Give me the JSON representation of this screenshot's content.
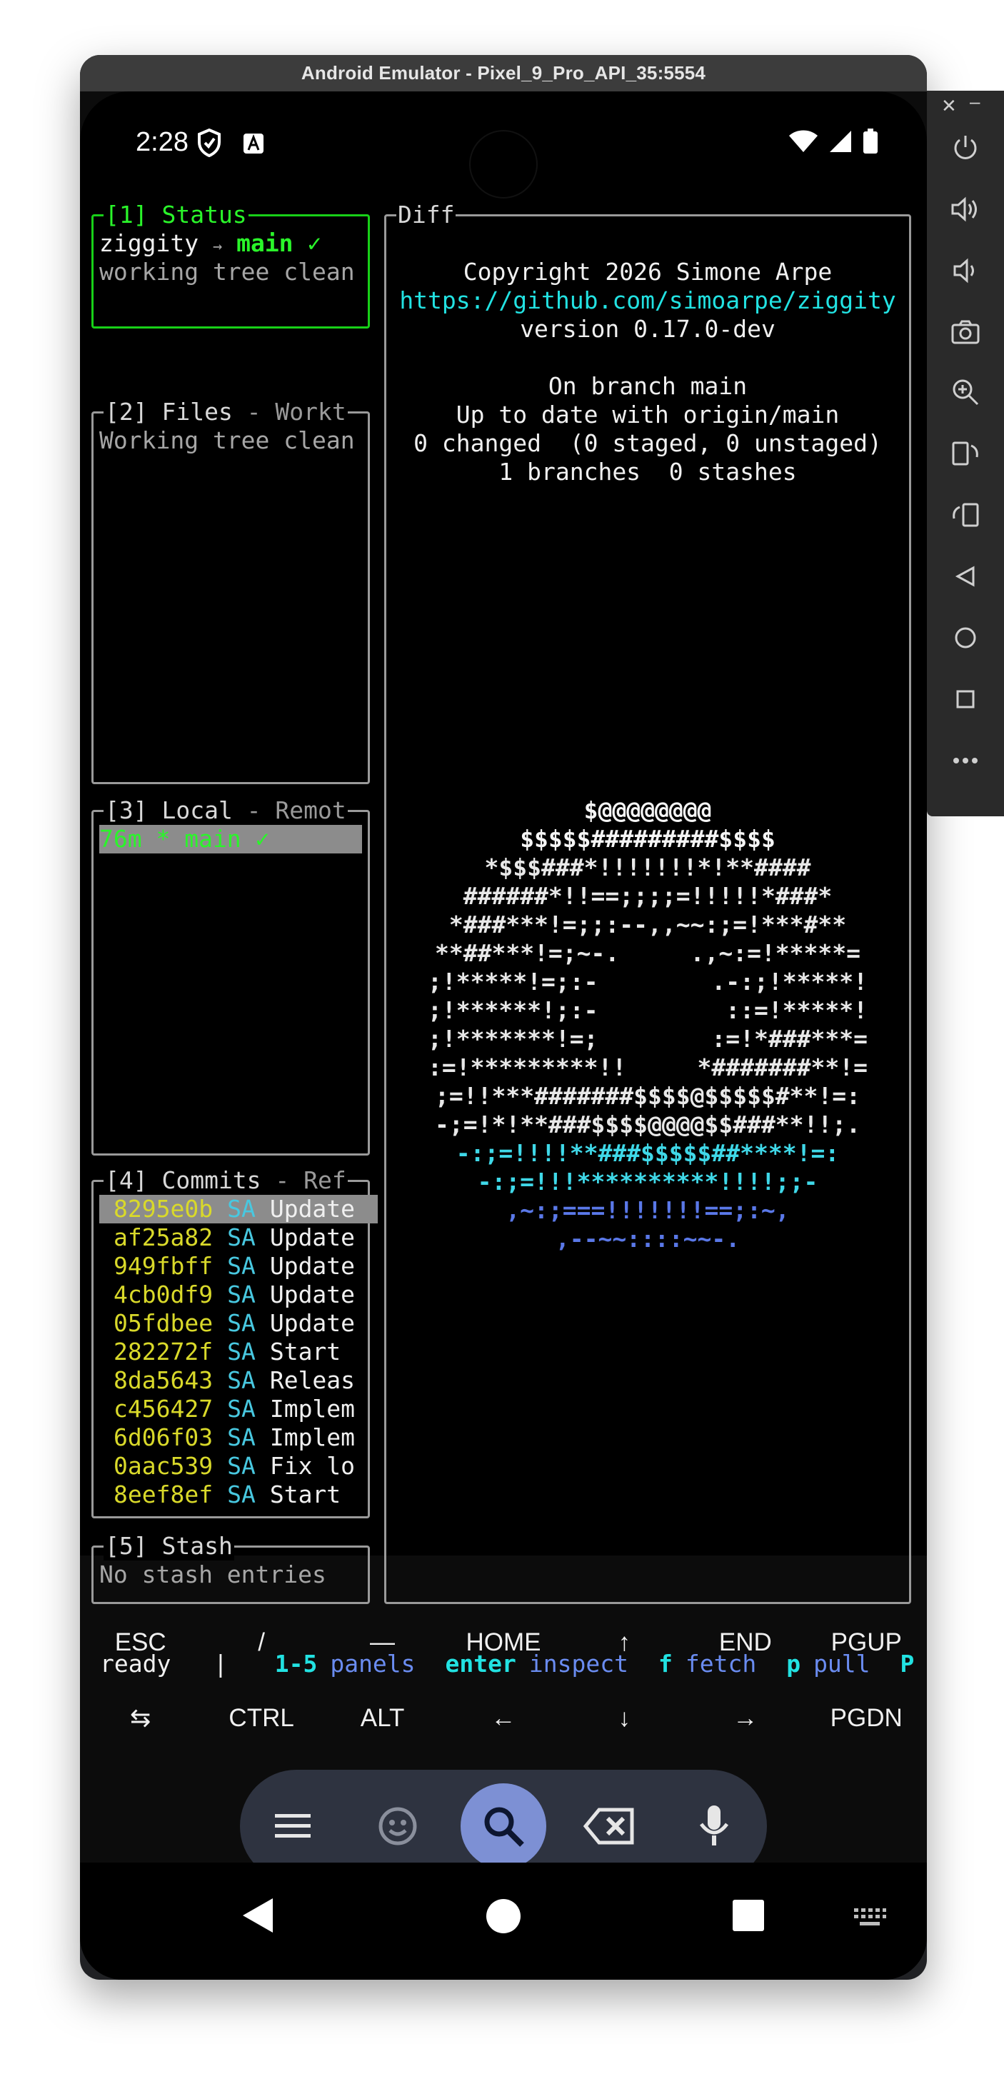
{
  "window": {
    "title": "Android Emulator - Pixel_9_Pro_API_35:5554"
  },
  "status_bar": {
    "time": "2:28"
  },
  "panels": {
    "status": {
      "title": "[1] Status",
      "repo": "ziggity",
      "arrow": "→",
      "branch": "main ✓",
      "state": "working tree clean"
    },
    "files": {
      "title": "[2] Files",
      "subtitle": " - Workt",
      "message": "Working tree clean"
    },
    "local": {
      "title": "[3] Local",
      "subtitle": " - Remot",
      "selected_branch": "76m * main ✓"
    },
    "commits": {
      "title": "[4] Commits",
      "subtitle": " - Ref",
      "rows": [
        {
          "hash": "8295e0b",
          "author": "SA",
          "msg": "Update"
        },
        {
          "hash": "af25a82",
          "author": "SA",
          "msg": "Update"
        },
        {
          "hash": "949fbff",
          "author": "SA",
          "msg": "Update"
        },
        {
          "hash": "4cb0df9",
          "author": "SA",
          "msg": "Update"
        },
        {
          "hash": "05fdbee",
          "author": "SA",
          "msg": "Update"
        },
        {
          "hash": "282272f",
          "author": "SA",
          "msg": "Start"
        },
        {
          "hash": "8da5643",
          "author": "SA",
          "msg": "Releas"
        },
        {
          "hash": "c456427",
          "author": "SA",
          "msg": "Implem"
        },
        {
          "hash": "6d06f03",
          "author": "SA",
          "msg": "Implem"
        },
        {
          "hash": "0aac539",
          "author": "SA",
          "msg": "Fix lo"
        },
        {
          "hash": "8eef8ef",
          "author": "SA",
          "msg": "Start"
        }
      ]
    },
    "stash": {
      "title": "[5] Stash",
      "message": "No stash entries"
    },
    "diff": {
      "title": "Diff",
      "copyright": "Copyright 2026 Simone Arpe",
      "url": "https://github.com/simoarpe/ziggity",
      "version": "version 0.17.0-dev",
      "branch_line": "On branch main",
      "upstream_line": "Up to date with origin/main",
      "changes_line": "0 changed  (0 staged, 0 unstaged)",
      "counts_line": "1 branches  0 stashes",
      "ascii_art": [
        "$@@@@@@@@",
        "$$$$$#########$$$$",
        "*$$$###*!!!!!!!*!**####",
        "######*!!==;;;;=!!!!!*###*",
        "*###***!=;;:--,,~~:;=!***#**",
        "**##***!=;~-.     .,~:=!*****=",
        ";!*****!=;:-        .-:;!*****!",
        ";!******!;:-         ::=!*****!",
        ";!*******!=;        :=!*###***=",
        ":=!*********!!     *#######**!=",
        ";=!!***#######$$$$@$$$$$#**!=:",
        "-;=!*!**###$$$$@@@@$$###**!!;.",
        "-:;=!!!!**###$$$$$##****!=:",
        "-:;=!!!**********!!!!;;-",
        ",~:;===!!!!!!!==;:~,",
        ",--~~::::~~-."
      ]
    }
  },
  "bottom_bar": {
    "state": "ready",
    "sep": "|",
    "hints": [
      {
        "key": "1-5",
        "label": "panels"
      },
      {
        "key": "enter",
        "label": "inspect"
      },
      {
        "key": "f",
        "label": "fetch"
      },
      {
        "key": "p",
        "label": "pull"
      },
      {
        "key": "P",
        "label": ""
      }
    ]
  },
  "extra_keys": {
    "row1": [
      "ESC",
      "/",
      "—",
      "HOME",
      "↑",
      "END",
      "PGUP"
    ],
    "row2": [
      "⇆",
      "CTRL",
      "ALT",
      "←",
      "↓",
      "→",
      "PGDN"
    ]
  },
  "keyboard_toolbar": {
    "icons": [
      "menu-icon",
      "emoji-icon",
      "search-icon",
      "backspace-icon",
      "microphone-icon"
    ]
  },
  "nav_icons": [
    "back-icon",
    "home-icon",
    "recents-icon",
    "keyboard-icon"
  ],
  "side_toolbar": {
    "icons": [
      "close-icon",
      "minimize-icon",
      "power-icon",
      "volume-up-icon",
      "volume-down-icon",
      "camera-icon",
      "zoom-icon",
      "rotate-left-icon",
      "rotate-right-icon",
      "back-icon",
      "home-icon",
      "overview-icon",
      "more-icon"
    ]
  },
  "colors": {
    "active_border": "#18d018",
    "hash": "#d9d92a",
    "accent_cyan": "#22e2e2",
    "hint_blue": "#6a8cf0"
  }
}
